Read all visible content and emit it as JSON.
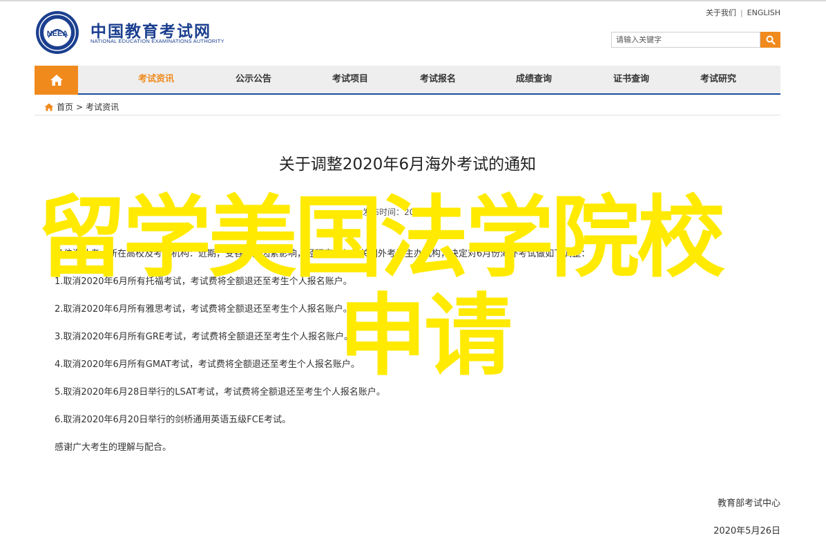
{
  "header": {
    "site_title": "中国教育考试网",
    "site_subtitle": "NATIONAL EDUCATION EXAMINATIONS AUTHORITY",
    "logo_text": "NEEA",
    "toplinks": {
      "favorite": "关于我们",
      "english": "ENGLISH"
    },
    "search": {
      "placeholder": "请输入关键字"
    }
  },
  "nav": {
    "items": [
      {
        "label": "考试资讯",
        "active": true
      },
      {
        "label": "公示公告"
      },
      {
        "label": "考试项目"
      },
      {
        "label": "考试报名"
      },
      {
        "label": "成绩查询"
      },
      {
        "label": "证书查询"
      },
      {
        "label": "考试研究"
      }
    ]
  },
  "breadcrumb": {
    "home": "首页",
    "separator": ">",
    "current": "考试资讯"
  },
  "article": {
    "title": "关于调整2020年6月海外考试的通知",
    "meta": "发布时间：2020-05-26",
    "intro": "各位海外考点所在高校及考试机构：近期，受各方面因素影响，经研究和与相关国外考试主办机构，决定对6月份海外考试做如下调整：",
    "items": [
      "1.取消2020年6月所有托福考试，考试费将全额退还至考生个人报名账户。",
      "2.取消2020年6月所有雅思考试，考试费将全额退还至考生个人报名账户。",
      "3.取消2020年6月所有GRE考试，考试费将全额退还至考生个人报名账户。",
      "4.取消2020年6月所有GMAT考试，考试费将全额退还至考生个人报名账户。",
      "5.取消2020年6月28日举行的LSAT考试，考试费将全额退还至考生个人报名账户。",
      "6.取消2020年6月20日举行的剑桥通用英语五级FCE考试。"
    ],
    "closing": "感谢广大考生的理解与配合。",
    "signature": "教育部考试中心",
    "date": "2020年5月26日"
  },
  "overlay": {
    "line1": "留学美国法学院校",
    "line2": "申请"
  },
  "colors": {
    "brand_blue": "#1b3f8f",
    "accent_orange": "#f08a1d",
    "overlay_yellow": "#ffea00"
  }
}
